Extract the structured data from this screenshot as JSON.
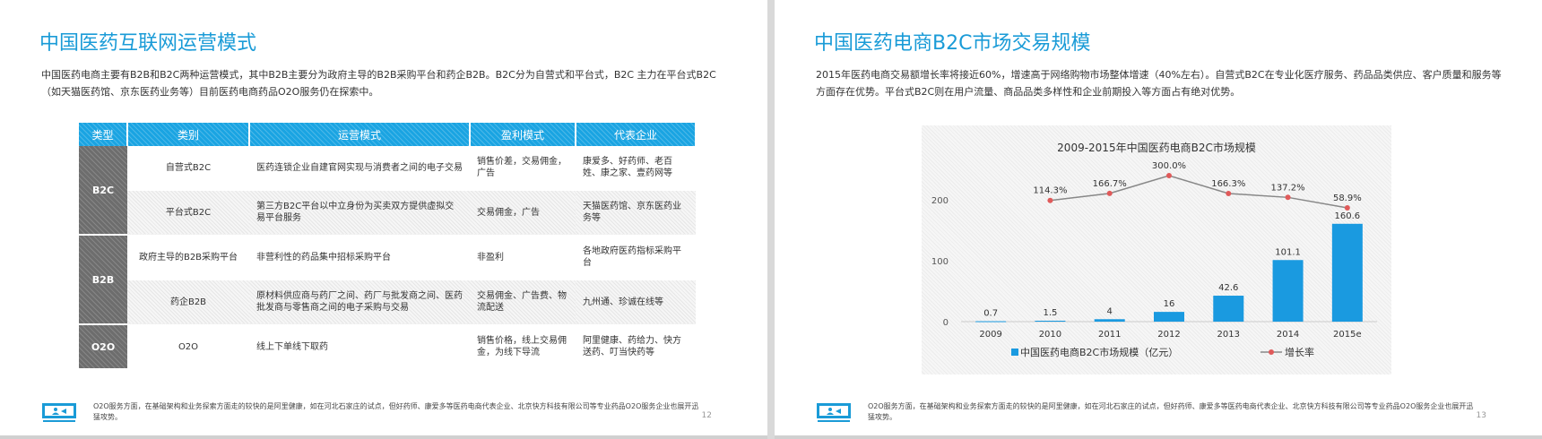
{
  "left": {
    "title": "中国医药互联网运营模式",
    "paragraph": "中国医药电商主要有B2B和B2C两种运营模式，其中B2B主要分为政府主导的B2B采购平台和药企B2B。B2C分为自营式和平台式，B2C 主力在平台式B2C（如天猫医药馆、京东医药业务等）目前医药电商药品O2O服务仍在探索中。",
    "table": {
      "headers": [
        "类型",
        "类别",
        "运营模式",
        "盈利模式",
        "代表企业"
      ],
      "categories": [
        "B2C",
        "B2B",
        "O2O"
      ],
      "rows": [
        {
          "category": "自营式B2C",
          "mode": "医药连锁企业自建官网实现与消费者之间的电子交易",
          "profit": "销售价差，交易佣金，广告",
          "companies": "康爱多、好药师、老百姓、康之家、壹药网等"
        },
        {
          "category": "平台式B2C",
          "mode": "第三方B2C平台以中立身份为买卖双方提供虚拟交易平台服务",
          "profit": "交易佣金，广告",
          "companies": "天猫医药馆、京东医药业务等"
        },
        {
          "category": "政府主导的B2B采购平台",
          "mode": "非营利性的药品集中招标采购平台",
          "profit": "非盈利",
          "companies": "各地政府医药指标采购平台"
        },
        {
          "category": "药企B2B",
          "mode": "原材料供应商与药厂之间、药厂与批发商之间、医药批发商与零售商之间的电子采购与交易",
          "profit": "交易佣金、广告费、物流配送",
          "companies": "九州通、珍诚在线等"
        },
        {
          "category": "O2O",
          "mode": "线上下单线下取药",
          "profit": "销售价格，线上交易佣金，为线下导流",
          "companies": "阿里健康、药给力、快方送药、叮当快药等"
        }
      ]
    },
    "footer_text": "O2O服务方面，在基础架构和业务探索方面走的较快的是阿里健康，如在河北石家庄的试点，但好药师、康爱多等医药电商代表企业、北京快方科技有限公司等专业药品O2O服务企业也展开迅猛攻势。",
    "page_number": "12"
  },
  "right": {
    "title": "中国医药电商B2C市场交易规模",
    "paragraph": "2015年医药电商交易额增长率将接近60%，增速高于网络购物市场整体增速（40%左右）。自营式B2C在专业化医疗服务、药品品类供应、客户质量和服务等方面存在优势。平台式B2C则在用户流量、商品品类多样性和企业前期投入等方面占有绝对优势。",
    "footer_text": "O2O服务方面，在基础架构和业务探索方面走的较快的是阿里健康，如在河北石家庄的试点，但好药师、康爱多等医药电商代表企业、北京快方科技有限公司等专业药品O2O服务企业也展开迅猛攻势。",
    "page_number": "13"
  },
  "chart_data": {
    "type": "bar",
    "title": "2009-2015年中国医药电商B2C市场规模",
    "categories": [
      "2009",
      "2010",
      "2011",
      "2012",
      "2013",
      "2014",
      "2015e"
    ],
    "series": [
      {
        "name": "中国医药电商B2C市场规模（亿元）",
        "type": "bar",
        "values": [
          0.7,
          1.5,
          4,
          16,
          42.6,
          101.1,
          160.6
        ],
        "labels": [
          "0.7",
          "1.5",
          "4",
          "16",
          "42.6",
          "101.1",
          "160.6"
        ],
        "color": "#1a9ae0"
      },
      {
        "name": "增长率",
        "type": "line",
        "values_pct": [
          114.3,
          166.7,
          300.0,
          166.3,
          137.2,
          58.9
        ],
        "labels": [
          "114.3%",
          "166.7%",
          "300.0%",
          "166.3%",
          "137.2%",
          "58.9%"
        ],
        "color": "#e05a5a",
        "line_color": "#888888"
      }
    ],
    "ylim": [
      0,
      200
    ],
    "yticks": [
      "0",
      "100",
      "200"
    ],
    "legend": "bottom",
    "grid": false
  },
  "colors": {
    "accent": "#1a9bd7",
    "header_bg": "#1aa4e2",
    "category_bg": "#6d6d6d"
  },
  "icons": {
    "footer": "presentation-icon"
  }
}
